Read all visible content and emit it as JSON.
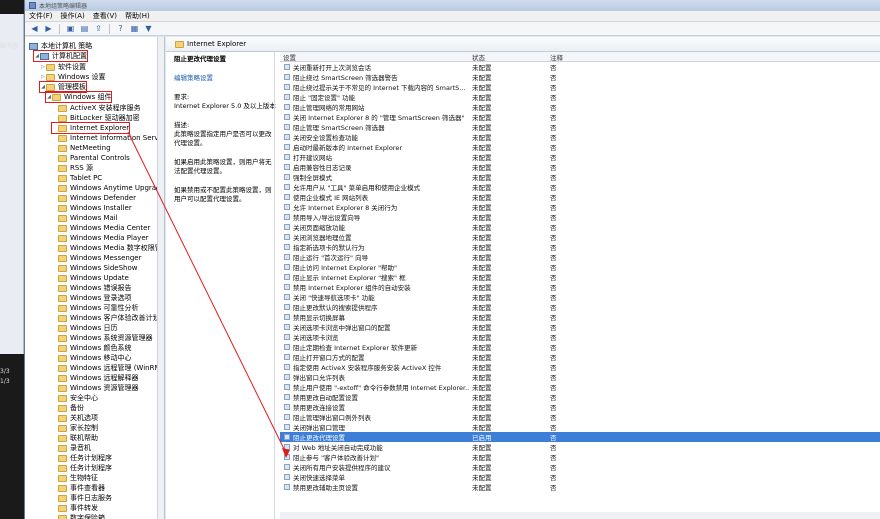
{
  "window": {
    "title": "本地组策略编辑器"
  },
  "left_strip": {
    "frag1": "结书签",
    "frag2": "3/3",
    "frag3": "1/3"
  },
  "menu": [
    "文件(F)",
    "操作(A)",
    "查看(V)",
    "帮助(H)"
  ],
  "tree": {
    "root": "本地计算机 策略",
    "computer_config": "计算机配置",
    "software_settings": "软件设置",
    "windows_settings": "Windows 设置",
    "admin_templates": "管理模板",
    "windows_components": "Windows 组件",
    "children": [
      "ActiveX 安装程序服务",
      "BitLocker 驱动器加密",
      "Internet Explorer",
      "Internet Information Services",
      "NetMeeting",
      "Parental Controls",
      "RSS 源",
      "Tablet PC",
      "Windows Anytime Upgrade",
      "Windows Defender",
      "Windows Installer",
      "Windows Mail",
      "Windows Media Center",
      "Windows Media Player",
      "Windows Media 数字权限管理",
      "Windows Messenger",
      "Windows SideShow",
      "Windows Update",
      "Windows 错误报告",
      "Windows 登录选项",
      "Windows 可靠性分析",
      "Windows 客户体验改善计划",
      "Windows 日历",
      "Windows 系统资源管理器",
      "Windows 颜色系统",
      "Windows 移动中心",
      "Windows 远程管理 (WinRM)",
      "Windows 远程解释器",
      "Windows 资源管理器",
      "安全中心",
      "备份",
      "关机选项",
      "家长控制",
      "联机帮助",
      "录音机",
      "任务计划程序",
      "任务计划程序",
      "生物特征",
      "事件查看器",
      "事件日志服务",
      "事件转发",
      "数字保险箱"
    ]
  },
  "right": {
    "header": "Internet Explorer",
    "desc_title": "阻止更改代理设置",
    "desc_edit_prefix": "编辑",
    "desc_edit_link": "策略设置",
    "desc_req_label": "要求:",
    "desc_req": "Internet Explorer 5.0 及以上版本",
    "desc_desc_label": "描述:",
    "desc_desc": "此策略设置指定用户是否可以更改代理设置。",
    "desc_p1": "如果启用此策略设置，则用户将无法配置代理设置。",
    "desc_p2": "如果禁用或不配置此策略设置，则用户可以配置代理设置。",
    "col_setting": "设置",
    "col_state": "状态",
    "col_note": "注释",
    "rows": [
      {
        "name": "关闭重新打开上次浏览会话",
        "state": "未配置",
        "note": "否"
      },
      {
        "name": "阻止绕过 SmartScreen 筛选器警告",
        "state": "未配置",
        "note": "否"
      },
      {
        "name": "阻止绕过提示关于不常见的 Internet 下载内容的 SmartS...",
        "state": "未配置",
        "note": "否"
      },
      {
        "name": "阻止 \"固定设置\" 功能",
        "state": "未配置",
        "note": "否"
      },
      {
        "name": "阻止管理网络的常用网站",
        "state": "未配置",
        "note": "否"
      },
      {
        "name": "关闭 Internet Explorer 8 的 \"管理 SmartScreen 筛选器\"",
        "state": "未配置",
        "note": "否"
      },
      {
        "name": "阻止管理 SmartScreen 筛选器",
        "state": "未配置",
        "note": "否"
      },
      {
        "name": "关闭安全设置检查功能",
        "state": "未配置",
        "note": "否"
      },
      {
        "name": "启动时最新版本的 Internet Explorer",
        "state": "未配置",
        "note": "否"
      },
      {
        "name": "打开建议网站",
        "state": "未配置",
        "note": "否"
      },
      {
        "name": "启用兼容性日志记录",
        "state": "未配置",
        "note": "否"
      },
      {
        "name": "强制全屏模式",
        "state": "未配置",
        "note": "否"
      },
      {
        "name": "允许用户从 \"工具\" 菜单启用和使用企业模式",
        "state": "未配置",
        "note": "否"
      },
      {
        "name": "使用企业模式 IE 网站列表",
        "state": "未配置",
        "note": "否"
      },
      {
        "name": "允许 Internet Explorer 8 关闭行为",
        "state": "未配置",
        "note": "否"
      },
      {
        "name": "禁用导入/导出设置向导",
        "state": "未配置",
        "note": "否"
      },
      {
        "name": "关闭页面缩放功能",
        "state": "未配置",
        "note": "否"
      },
      {
        "name": "关闭浏览器地理位置",
        "state": "未配置",
        "note": "否"
      },
      {
        "name": "指定新选项卡的默认行为",
        "state": "未配置",
        "note": "否"
      },
      {
        "name": "阻止运行 \"首次运行\" 向导",
        "state": "未配置",
        "note": "否"
      },
      {
        "name": "阻止访问 Internet Explorer \"帮助\"",
        "state": "未配置",
        "note": "否"
      },
      {
        "name": "阻止显示 Internet Explorer \"搜索\" 框",
        "state": "未配置",
        "note": "否"
      },
      {
        "name": "禁用 Internet Explorer 组件的自动安装",
        "state": "未配置",
        "note": "否"
      },
      {
        "name": "关闭 \"快速导航选项卡\" 功能",
        "state": "未配置",
        "note": "否"
      },
      {
        "name": "阻止更改默认的搜索提供程序",
        "state": "未配置",
        "note": "否"
      },
      {
        "name": "禁用显示切换屏幕",
        "state": "未配置",
        "note": "否"
      },
      {
        "name": "关闭选项卡浏览中弹出窗口的配置",
        "state": "未配置",
        "note": "否"
      },
      {
        "name": "关闭选项卡浏览",
        "state": "未配置",
        "note": "否"
      },
      {
        "name": "阻止定期检查 Internet Explorer 软件更新",
        "state": "未配置",
        "note": "否"
      },
      {
        "name": "阻止打开窗口方式的配置",
        "state": "未配置",
        "note": "否"
      },
      {
        "name": "指定使用 ActiveX 安装程序服务安装 ActiveX 控件",
        "state": "未配置",
        "note": "否"
      },
      {
        "name": "弹出窗口允许列表",
        "state": "未配置",
        "note": "否"
      },
      {
        "name": "禁止用户使用 \"-extoff\" 命令行参数禁用 Internet Explorer...",
        "state": "未配置",
        "note": "否"
      },
      {
        "name": "禁用更改自动配置设置",
        "state": "未配置",
        "note": "否"
      },
      {
        "name": "禁用更改连接设置",
        "state": "未配置",
        "note": "否"
      },
      {
        "name": "阻止管理弹出窗口例外列表",
        "state": "未配置",
        "note": "否"
      },
      {
        "name": "关闭弹出窗口管理",
        "state": "未配置",
        "note": "否"
      },
      {
        "name": "阻止更改代理设置",
        "state": "已启用",
        "note": "否"
      },
      {
        "name": "对 Web 地址关闭自动完成功能",
        "state": "未配置",
        "note": "否"
      },
      {
        "name": "阻止参与 \"客户体验改善计划\"",
        "state": "未配置",
        "note": "否"
      },
      {
        "name": "关闭所有用户安装提供程序的建议",
        "state": "未配置",
        "note": "否"
      },
      {
        "name": "关闭快速选择菜单",
        "state": "未配置",
        "note": "否"
      },
      {
        "name": "禁用更改辅助主页设置",
        "state": "未配置",
        "note": "否"
      }
    ]
  },
  "colors": {
    "highlight": "#e21c1c",
    "selection": "#3d7ed8"
  }
}
